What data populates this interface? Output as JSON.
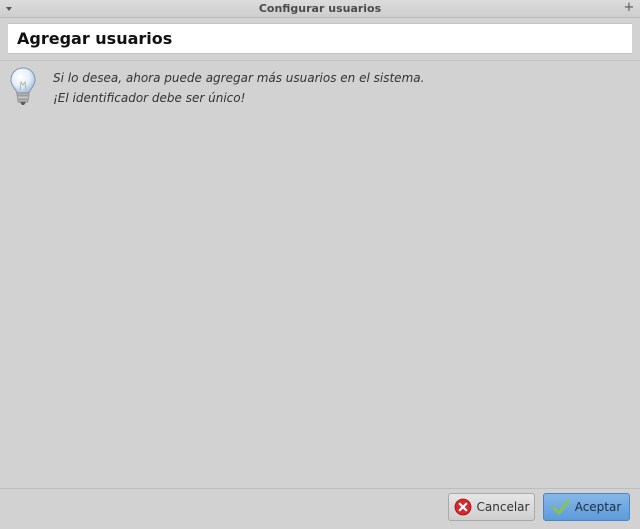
{
  "window": {
    "title": "Configurar usuarios"
  },
  "header": {
    "heading": "Agregar usuarios"
  },
  "info": {
    "line1": "Si lo desea, ahora puede agregar más usuarios en el sistema.",
    "line2": "¡El identificador debe ser único!"
  },
  "buttons": {
    "cancel_label": "Cancelar",
    "ok_label": "Aceptar"
  },
  "icons": {
    "window_menu": "chevron-down-icon",
    "maximize": "plus-icon",
    "info": "lightbulb-icon",
    "cancel": "cancel-circle-icon",
    "ok": "checkmark-icon"
  },
  "colors": {
    "window_bg": "#d2d2d2",
    "header_bg": "#ffffff",
    "ok_button": "#5d9bd9",
    "cancel_icon": "#d9262a",
    "ok_icon": "#8bc34a"
  }
}
